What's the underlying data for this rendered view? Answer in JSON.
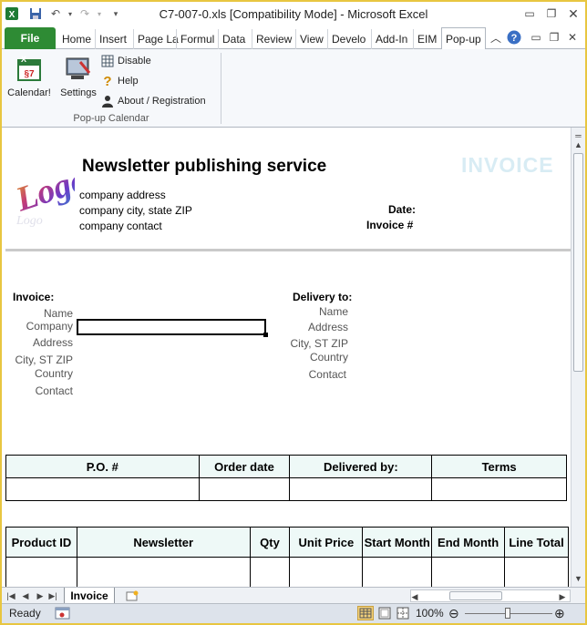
{
  "window": {
    "title": "C7-007-0.xls  [Compatibility Mode]  -  Microsoft Excel"
  },
  "ribbon": {
    "tabs": [
      "File",
      "Home",
      "Insert",
      "Page La",
      "Formul",
      "Data",
      "Review",
      "View",
      "Develo",
      "Add-In",
      "EIM",
      "Pop-up"
    ],
    "buttons": {
      "calendar": "Calendar!",
      "settings": "Settings",
      "disable": "Disable",
      "help": "Help",
      "about": "About / Registration"
    },
    "group_name": "Pop-up Calendar"
  },
  "invoice": {
    "company_name": "Newsletter publishing service",
    "banner": "INVOICE",
    "logo_text": "Logo",
    "company_address": "company address",
    "company_city": "company city, state ZIP",
    "company_contact": "company contact",
    "date_label": "Date:",
    "invoice_no_label": "Invoice #",
    "bill_to": {
      "heading": "Invoice:",
      "name": "Name",
      "company": "Company",
      "address": "Address",
      "city": "City, ST ZIP",
      "country": "Country",
      "contact": "Contact"
    },
    "delivery_to": {
      "heading": "Delivery to:",
      "name": "Name",
      "address": "Address",
      "city": "City, ST ZIP",
      "country": "Country",
      "contact": "Contact"
    },
    "order_table": {
      "headers": [
        "P.O. #",
        "Order date",
        "Delivered by:",
        "Terms"
      ]
    },
    "items_table": {
      "headers": [
        "Product ID",
        "Newsletter",
        "Qty",
        "Unit Price",
        "Start Month",
        "End Month",
        "Line Total"
      ]
    }
  },
  "sheet_tabs": {
    "active": "Invoice"
  },
  "status": {
    "ready": "Ready",
    "zoom": "100%"
  }
}
